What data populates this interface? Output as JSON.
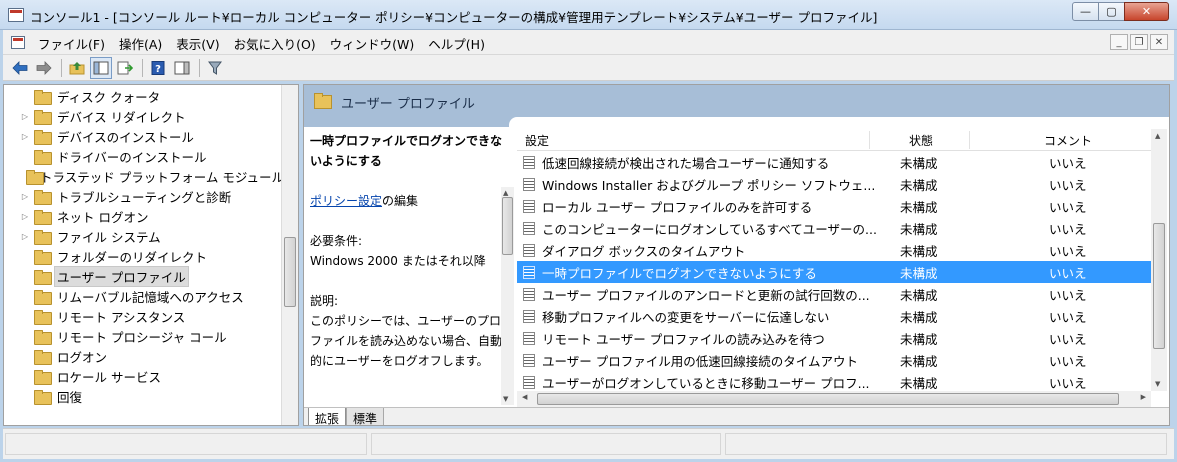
{
  "window": {
    "title": "コンソール1 - [コンソール ルート¥ローカル コンピューター ポリシー¥コンピューターの構成¥管理用テンプレート¥システム¥ユーザー プロファイル]",
    "buttons": [
      "minimize",
      "maximize",
      "close"
    ]
  },
  "menu": {
    "items": [
      {
        "label": "ファイル(F)"
      },
      {
        "label": "操作(A)"
      },
      {
        "label": "表示(V)"
      },
      {
        "label": "お気に入り(O)"
      },
      {
        "label": "ウィンドウ(W)"
      },
      {
        "label": "ヘルプ(H)"
      }
    ]
  },
  "toolbar": {
    "icons": [
      "back-arrow-icon",
      "forward-arrow-icon",
      "up-folder-icon",
      "console-tree-icon",
      "export-list-icon",
      "help-icon",
      "show-hide-icon",
      "filter-icon"
    ]
  },
  "tree": {
    "items": [
      {
        "label": "ディスク クォータ",
        "expandable": false
      },
      {
        "label": "デバイス リダイレクト",
        "expandable": true
      },
      {
        "label": "デバイスのインストール",
        "expandable": true
      },
      {
        "label": "ドライバーのインストール",
        "expandable": false
      },
      {
        "label": "トラステッド プラットフォーム モジュール",
        "expandable": false
      },
      {
        "label": "トラブルシューティングと診断",
        "expandable": true
      },
      {
        "label": "ネット ログオン",
        "expandable": true
      },
      {
        "label": "ファイル システム",
        "expandable": true
      },
      {
        "label": "フォルダーのリダイレクト",
        "expandable": false
      },
      {
        "label": "ユーザー プロファイル",
        "expandable": false,
        "selected": true
      },
      {
        "label": "リムーバブル記憶域へのアクセス",
        "expandable": false
      },
      {
        "label": "リモート アシスタンス",
        "expandable": false
      },
      {
        "label": "リモート プロシージャ コール",
        "expandable": false
      },
      {
        "label": "ログオン",
        "expandable": false
      },
      {
        "label": "ロケール サービス",
        "expandable": false
      },
      {
        "label": "回復",
        "expandable": false
      }
    ]
  },
  "panel": {
    "title": "ユーザー プロファイル"
  },
  "description": {
    "policy_title": "一時プロファイルでログオンできないようにする",
    "link": "ポリシー設定",
    "link_suffix": "の編集",
    "req_label": "必要条件:",
    "req_value": "Windows 2000 またはそれ以降",
    "desc_label": "説明:",
    "desc_text": "このポリシーでは、ユーザーのプロファイルを読み込めない場合、自動的にユーザーをログオフします。"
  },
  "list": {
    "headers": {
      "setting": "設定",
      "state": "状態",
      "comment": "コメント"
    },
    "rows": [
      {
        "setting": "低速回線接続が検出された場合ユーザーに通知する",
        "state": "未構成",
        "comment": "いいえ"
      },
      {
        "setting": "Windows Installer およびグループ ポリシー ソフトウェ...",
        "state": "未構成",
        "comment": "いいえ"
      },
      {
        "setting": "ローカル ユーザー プロファイルのみを許可する",
        "state": "未構成",
        "comment": "いいえ"
      },
      {
        "setting": "このコンピューターにログオンしているすべてユーザーの...",
        "state": "未構成",
        "comment": "いいえ"
      },
      {
        "setting": "ダイアログ ボックスのタイムアウト",
        "state": "未構成",
        "comment": "いいえ"
      },
      {
        "setting": "一時プロファイルでログオンできないようにする",
        "state": "未構成",
        "comment": "いいえ",
        "selected": true
      },
      {
        "setting": "ユーザー プロファイルのアンロードと更新の試行回数の...",
        "state": "未構成",
        "comment": "いいえ"
      },
      {
        "setting": "移動プロファイルへの変更をサーバーに伝達しない",
        "state": "未構成",
        "comment": "いいえ"
      },
      {
        "setting": "リモート ユーザー プロファイルの読み込みを待つ",
        "state": "未構成",
        "comment": "いいえ"
      },
      {
        "setting": "ユーザー プロファイル用の低速回線接続のタイムアウト",
        "state": "未構成",
        "comment": "いいえ"
      },
      {
        "setting": "ユーザーがログオンしているときに移動ユーザー プロフ...",
        "state": "未構成",
        "comment": "いいえ"
      }
    ]
  },
  "tabs": [
    {
      "label": "拡張",
      "active": true
    },
    {
      "label": "標準",
      "active": false
    }
  ]
}
